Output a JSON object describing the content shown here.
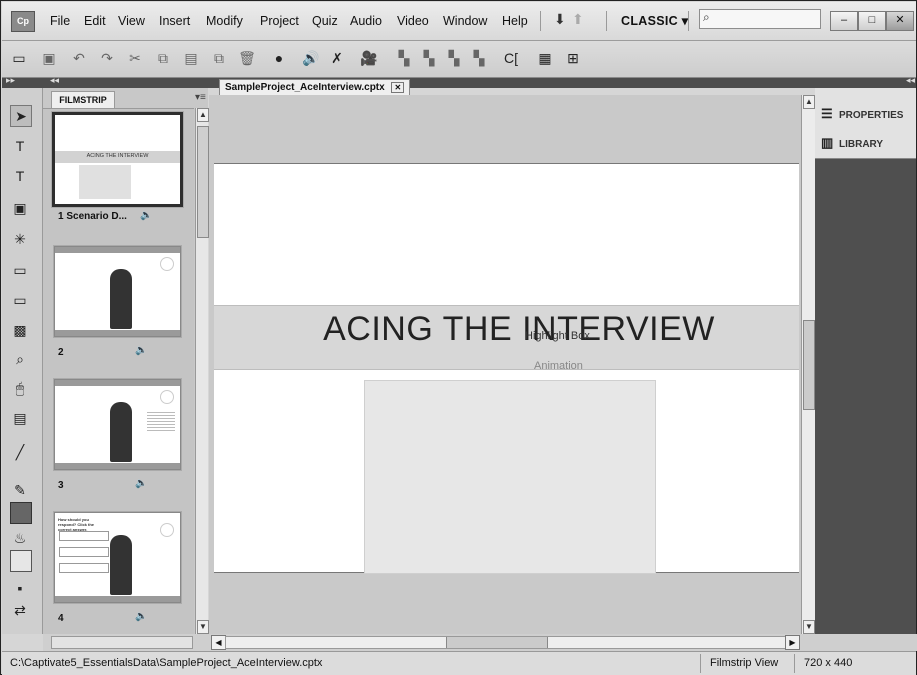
{
  "menu": {
    "app_logo": "Cp",
    "items": [
      "File",
      "Edit",
      "View",
      "Insert",
      "Modify",
      "Project",
      "Quiz",
      "Audio",
      "Video",
      "Window",
      "Help"
    ],
    "workspace": "CLASSIC",
    "workspace_arrow": "▾",
    "search_icon": "⌕"
  },
  "window_controls": {
    "minimize": "–",
    "maximize": "□",
    "close": "✕"
  },
  "toolbar_icons": [
    "open-folder",
    "save",
    "undo",
    "redo",
    "cut",
    "copy",
    "paste",
    "duplicate",
    "delete",
    "record",
    "audio",
    "remove-audio",
    "video",
    "align-1",
    "align-2",
    "align-3",
    "align-4",
    "captions",
    "table",
    "properties"
  ],
  "filmstrip": {
    "tab_label": "FILMSTRIP",
    "menu_icon": "▾≡",
    "slides": [
      {
        "label": "1 Scenario D...",
        "thumb_text": "ACING THE INTERVIEW",
        "audio": "🔈"
      },
      {
        "label": "2",
        "audio": "🔈"
      },
      {
        "label": "3",
        "audio": "🔈"
      },
      {
        "label": "4",
        "audio": "🔈",
        "thumb_text": "How should you respond? Click the correct answer."
      }
    ]
  },
  "document": {
    "tab_label": "SampleProject_AceInterview.cptx",
    "tab_close": "✕",
    "slide_title": "ACING THE INTERVIEW",
    "highlight_box_label": "Highlight Box",
    "animation_label": "Animation"
  },
  "right_panel": {
    "properties_label": "PROPERTIES",
    "library_label": "LIBRARY"
  },
  "status_bar": {
    "path": "C:\\Captivate5_EssentialsData\\SampleProject_AceInterview.cptx",
    "view": "Filmstrip View",
    "size": "720 x 440"
  },
  "colors": {
    "dark_panel": "#4f4f4f",
    "title_band": "#d7d7d7",
    "chrome": "#d6d6d6"
  }
}
